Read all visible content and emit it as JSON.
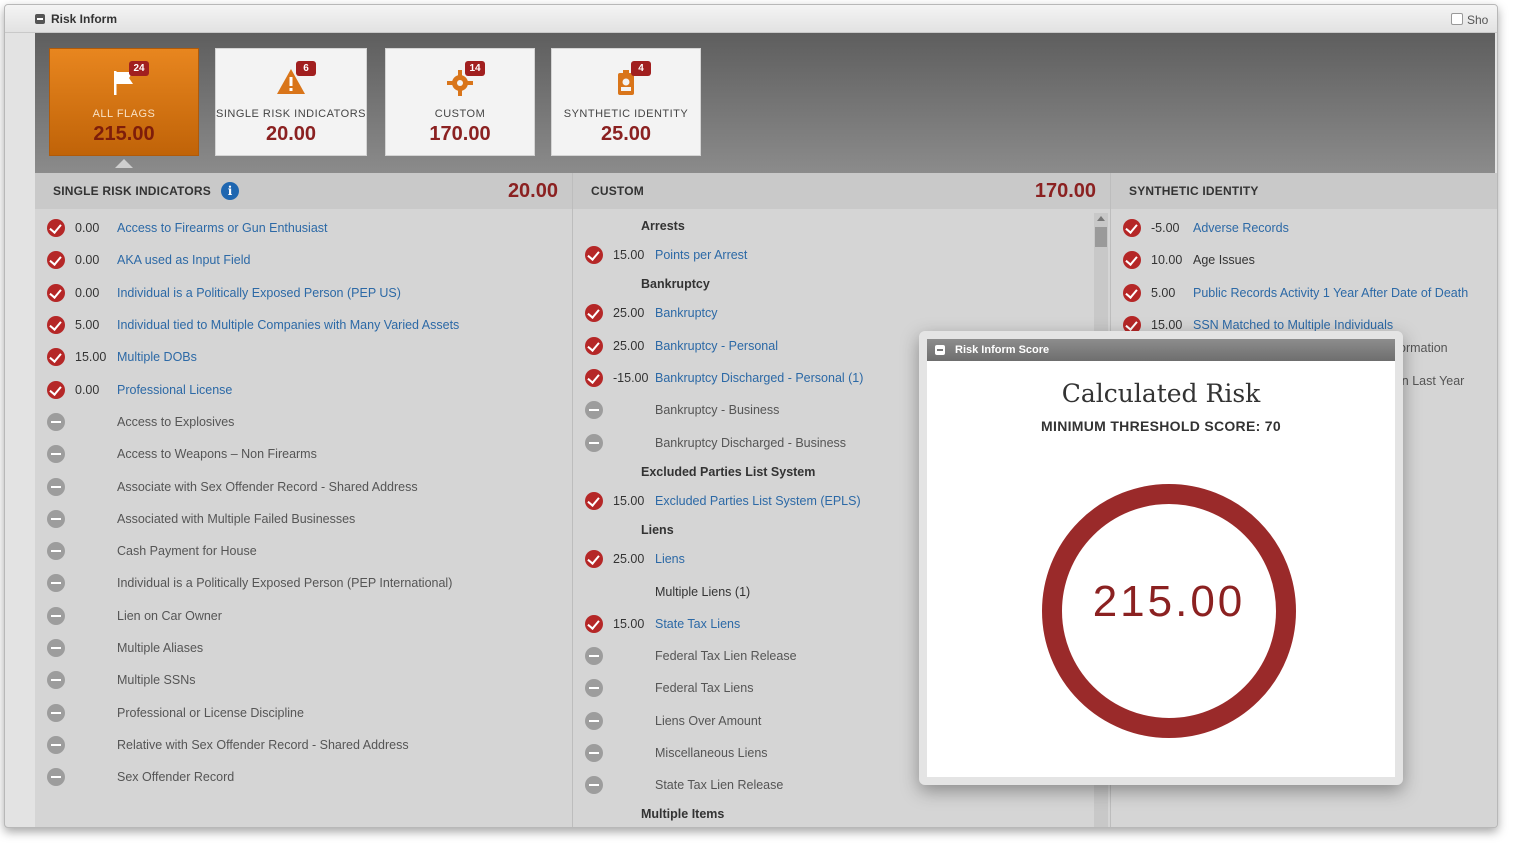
{
  "window": {
    "title": "Risk Inform",
    "show_label": "Sho"
  },
  "tiles": [
    {
      "label": "ALL FLAGS",
      "badge": "24",
      "value": "215.00",
      "icon": "flag-icon",
      "active": true
    },
    {
      "label": "SINGLE RISK INDICATORS",
      "badge": "6",
      "value": "20.00",
      "icon": "warning-icon",
      "active": false
    },
    {
      "label": "CUSTOM",
      "badge": "14",
      "value": "170.00",
      "icon": "gear-icon",
      "active": false
    },
    {
      "label": "SYNTHETIC IDENTITY",
      "badge": "4",
      "value": "25.00",
      "icon": "id-badge-icon",
      "active": false
    }
  ],
  "colors": {
    "accent_orange": "#d9751a",
    "score_red": "#8b2121",
    "flag_red": "#b52727",
    "link_blue": "#2c69a6"
  },
  "single": {
    "title": "SINGLE RISK INDICATORS",
    "total": "20.00",
    "rows": [
      {
        "score": "0.00",
        "label": "Access to Firearms or Gun Enthusiast",
        "flagged": true
      },
      {
        "score": "0.00",
        "label": "AKA used as Input Field",
        "flagged": true
      },
      {
        "score": "0.00",
        "label": "Individual is a Politically Exposed Person (PEP US)",
        "flagged": true
      },
      {
        "score": "5.00",
        "label": "Individual tied to Multiple Companies with Many Varied Assets",
        "flagged": true
      },
      {
        "score": "15.00",
        "label": "Multiple DOBs",
        "flagged": true
      },
      {
        "score": "0.00",
        "label": "Professional License",
        "flagged": true
      },
      {
        "score": "",
        "label": "Access to Explosives",
        "flagged": false
      },
      {
        "score": "",
        "label": "Access to Weapons – Non Firearms",
        "flagged": false
      },
      {
        "score": "",
        "label": "Associate with Sex Offender Record - Shared Address",
        "flagged": false
      },
      {
        "score": "",
        "label": "Associated with Multiple Failed Businesses",
        "flagged": false
      },
      {
        "score": "",
        "label": "Cash Payment for House",
        "flagged": false
      },
      {
        "score": "",
        "label": "Individual is a Politically Exposed Person (PEP International)",
        "flagged": false
      },
      {
        "score": "",
        "label": "Lien on Car Owner",
        "flagged": false
      },
      {
        "score": "",
        "label": "Multiple Aliases",
        "flagged": false
      },
      {
        "score": "",
        "label": "Multiple SSNs",
        "flagged": false
      },
      {
        "score": "",
        "label": "Professional or License Discipline",
        "flagged": false
      },
      {
        "score": "",
        "label": "Relative with Sex Offender Record - Shared Address",
        "flagged": false
      },
      {
        "score": "",
        "label": "Sex Offender Record",
        "flagged": false
      }
    ]
  },
  "custom": {
    "title": "CUSTOM",
    "total": "170.00",
    "groups": [
      {
        "name": "Arrests",
        "rows": [
          {
            "score": "15.00",
            "label": "Points per Arrest",
            "flagged": true
          }
        ]
      },
      {
        "name": "Bankruptcy",
        "rows": [
          {
            "score": "25.00",
            "label": "Bankruptcy",
            "flagged": true
          },
          {
            "score": "25.00",
            "label": "Bankruptcy - Personal",
            "flagged": true
          },
          {
            "score": "-15.00",
            "label": "Bankruptcy Discharged - Personal (1)",
            "flagged": true
          },
          {
            "score": "",
            "label": "Bankruptcy - Business",
            "flagged": false
          },
          {
            "score": "",
            "label": "Bankruptcy Discharged - Business",
            "flagged": false
          }
        ]
      },
      {
        "name": "Excluded Parties List System",
        "rows": [
          {
            "score": "15.00",
            "label": "Excluded Parties List System (EPLS)",
            "flagged": true
          }
        ]
      },
      {
        "name": "Liens",
        "rows": [
          {
            "score": "25.00",
            "label": "Liens",
            "flagged": true
          },
          {
            "score": "",
            "label": "Multiple Liens (1)",
            "flagged": null
          },
          {
            "score": "15.00",
            "label": "State Tax Liens",
            "flagged": true
          },
          {
            "score": "",
            "label": "Federal Tax Lien Release",
            "flagged": false
          },
          {
            "score": "",
            "label": "Federal Tax Liens",
            "flagged": false
          },
          {
            "score": "",
            "label": "Liens Over Amount",
            "flagged": false
          },
          {
            "score": "",
            "label": "Miscellaneous Liens",
            "flagged": false
          },
          {
            "score": "",
            "label": "State Tax Lien Release",
            "flagged": false
          }
        ]
      },
      {
        "name": "Multiple Items",
        "rows": []
      }
    ]
  },
  "synthetic": {
    "title": "SYNTHETIC IDENTITY",
    "rows": [
      {
        "score": "-5.00",
        "label": "Adverse Records",
        "flagged": true,
        "link": true
      },
      {
        "score": "10.00",
        "label": "Age Issues",
        "flagged": true,
        "link": false
      },
      {
        "score": "5.00",
        "label": "Public Records Activity 1 Year After Date of Death",
        "flagged": true,
        "link": true
      },
      {
        "score": "15.00",
        "label": "SSN Matched to Multiple Individuals",
        "flagged": true,
        "link": true
      }
    ],
    "partial_rows": [
      "ormation",
      "in Last Year"
    ]
  },
  "popup": {
    "title": "Risk Inform Score",
    "heading": "Calculated Risk",
    "threshold": "MINIMUM THRESHOLD SCORE: 70",
    "score": "215.00"
  }
}
